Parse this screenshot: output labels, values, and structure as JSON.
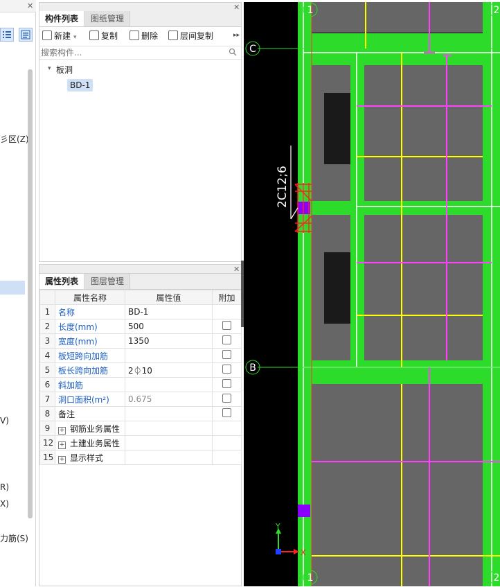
{
  "left_panel": {
    "items": [
      "彡区(Z)",
      "V)",
      "R)",
      "X)",
      "力筋(S)"
    ]
  },
  "component_panel": {
    "tabs": [
      "构件列表",
      "图纸管理"
    ],
    "toolbar": {
      "new": "新建",
      "copy": "复制",
      "delete": "删除",
      "floor_copy": "层间复制"
    },
    "search_placeholder": "搜索构件...",
    "tree": {
      "group": "板洞",
      "item": "BD-1"
    }
  },
  "property_panel": {
    "tabs": [
      "属性列表",
      "图层管理"
    ],
    "headers": {
      "name": "属性名称",
      "value": "属性值",
      "extra": "附加"
    },
    "rows": [
      {
        "num": "1",
        "name": "名称",
        "value": "BD-1",
        "checkbox": false
      },
      {
        "num": "2",
        "name": "长度(mm)",
        "value": "500",
        "checkbox": true
      },
      {
        "num": "3",
        "name": "宽度(mm)",
        "value": "1350",
        "checkbox": true
      },
      {
        "num": "4",
        "name": "板短跨向加筋",
        "value": "",
        "checkbox": true
      },
      {
        "num": "5",
        "name": "板长跨向加筋",
        "value": "2⏀10",
        "checkbox": true
      },
      {
        "num": "6",
        "name": "斜加筋",
        "value": "",
        "checkbox": true
      },
      {
        "num": "7",
        "name": "洞口面积(m²)",
        "value": "0.675",
        "checkbox": true
      },
      {
        "num": "8",
        "name": "备注",
        "value": "",
        "checkbox": true
      },
      {
        "num": "9",
        "name": "钢筋业务属性",
        "value": "",
        "checkbox": false
      },
      {
        "num": "12",
        "name": "土建业务属性",
        "value": "",
        "checkbox": false
      },
      {
        "num": "15",
        "name": "显示样式",
        "value": "",
        "checkbox": false
      }
    ]
  },
  "cad": {
    "axis_labels": {
      "col1_top": "1",
      "col2_top": "2",
      "rowC": "C",
      "rowB": "B",
      "col1_bottom": "1",
      "col2_bottom": "2"
    },
    "rebar_text": "2C12;6",
    "ucs": {
      "x": "X",
      "y": "Y"
    },
    "colors": {
      "background": "#000000",
      "beam": "#2ddc2a",
      "slab": "#666666",
      "rebar_yellow": "#ffff00",
      "rebar_magenta": "#ff40ff",
      "hole": "#8a00ff"
    }
  }
}
